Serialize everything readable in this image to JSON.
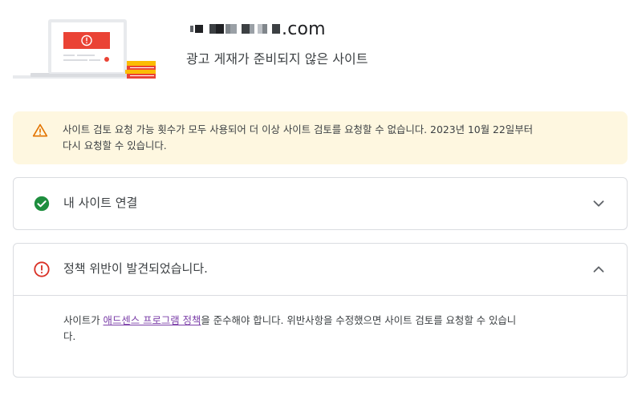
{
  "header": {
    "domain_suffix": ".com",
    "site_status": "광고 게재가 준비되지 않은 사이트"
  },
  "warning": {
    "icon": "warning-icon",
    "text_line1": "사이트 검토 요청 가능 횟수가 모두 사용되어 더 이상 사이트 검토를 요청할 수 없습니다. 2023년 10월 22일부터",
    "text_line2": "다시 요청할 수 있습니다."
  },
  "cards": {
    "connect": {
      "title": "내 사이트 연결",
      "icon": "check-circle-icon",
      "expanded": false
    },
    "policy": {
      "title": "정책 위반이 발견되었습니다.",
      "icon": "error-circle-icon",
      "expanded": true,
      "body_prefix": "사이트가 ",
      "body_link": "애드센스 프로그램 정책",
      "body_line1_rest": "을 준수해야 합니다. 위반사항을 수정했으면 사이트 검토를 요청할 수 있습니",
      "body_line2": "다."
    }
  },
  "colors": {
    "warning_bg": "#fef7e0",
    "warning_icon": "#e37400",
    "success": "#1e8e3e",
    "error": "#d93025",
    "link": "#7b3ea8",
    "border": "#dadce0"
  }
}
